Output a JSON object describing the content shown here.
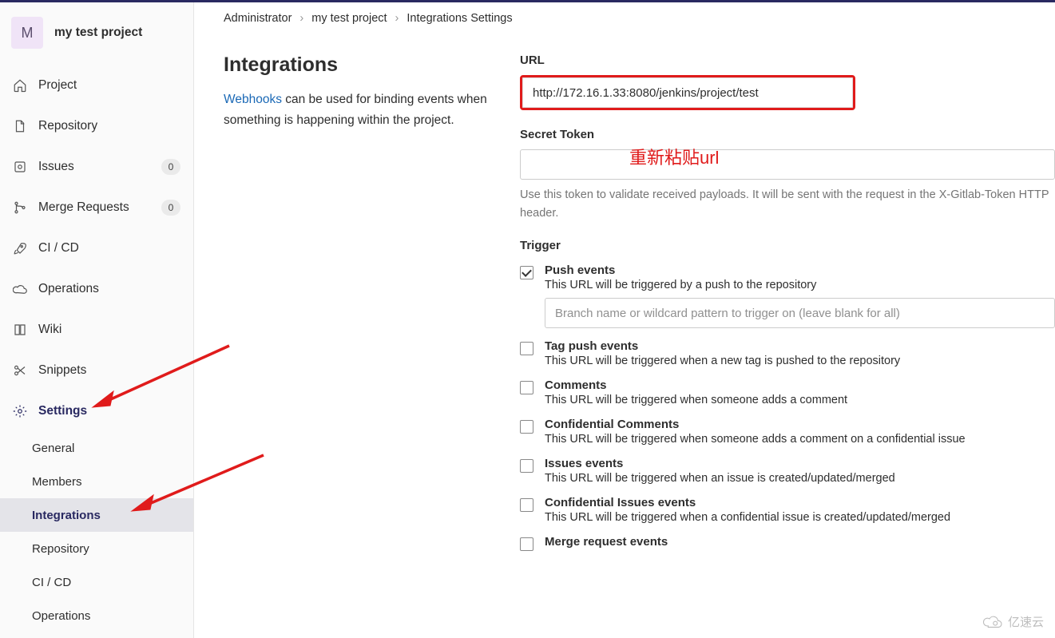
{
  "project": {
    "initial": "M",
    "name": "my test project"
  },
  "sidebar": {
    "items": [
      {
        "label": "Project",
        "icon": "home",
        "count": null
      },
      {
        "label": "Repository",
        "icon": "file",
        "count": null
      },
      {
        "label": "Issues",
        "icon": "issue",
        "count": "0"
      },
      {
        "label": "Merge Requests",
        "icon": "merge",
        "count": "0"
      },
      {
        "label": "CI / CD",
        "icon": "rocket",
        "count": null
      },
      {
        "label": "Operations",
        "icon": "cloud",
        "count": null
      },
      {
        "label": "Wiki",
        "icon": "book",
        "count": null
      },
      {
        "label": "Snippets",
        "icon": "scissors",
        "count": null
      },
      {
        "label": "Settings",
        "icon": "gear",
        "count": null
      }
    ],
    "settings_sub": [
      "General",
      "Members",
      "Integrations",
      "Repository",
      "CI / CD",
      "Operations"
    ]
  },
  "breadcrumbs": [
    "Administrator",
    "my test project",
    "Integrations Settings"
  ],
  "page": {
    "title": "Integrations",
    "desc_link": "Webhooks",
    "desc_rest": " can be used for binding events when something is happening within the project."
  },
  "form": {
    "url_label": "URL",
    "url_value": "http://172.16.1.33:8080/jenkins/project/test",
    "token_label": "Secret Token",
    "token_value": "",
    "token_help": "Use this token to validate received payloads. It will be sent with the request in the X-Gitlab-Token HTTP header.",
    "trigger_label": "Trigger",
    "branch_placeholder": "Branch name or wildcard pattern to trigger on (leave blank for all)",
    "triggers": [
      {
        "title": "Push events",
        "desc": "This URL will be triggered by a push to the repository",
        "checked": true,
        "has_input": true
      },
      {
        "title": "Tag push events",
        "desc": "This URL will be triggered when a new tag is pushed to the repository",
        "checked": false
      },
      {
        "title": "Comments",
        "desc": "This URL will be triggered when someone adds a comment",
        "checked": false
      },
      {
        "title": "Confidential Comments",
        "desc": "This URL will be triggered when someone adds a comment on a confidential issue",
        "checked": false
      },
      {
        "title": "Issues events",
        "desc": "This URL will be triggered when an issue is created/updated/merged",
        "checked": false
      },
      {
        "title": "Confidential Issues events",
        "desc": "This URL will be triggered when a confidential issue is created/updated/merged",
        "checked": false
      },
      {
        "title": "Merge request events",
        "desc": "",
        "checked": false
      }
    ]
  },
  "annotation": {
    "text": "重新粘贴url"
  },
  "watermark": "亿速云"
}
